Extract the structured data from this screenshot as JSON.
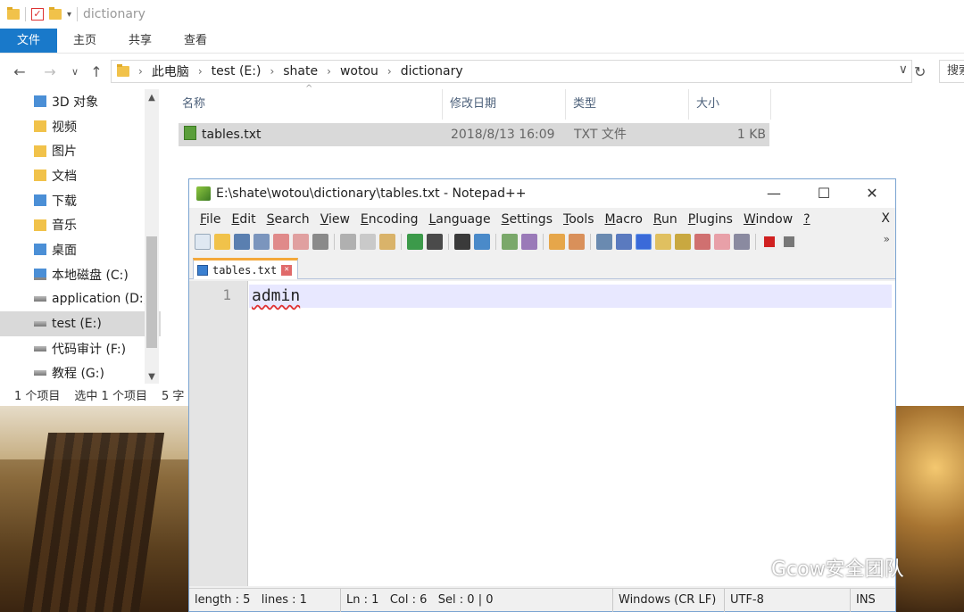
{
  "explorer": {
    "title_path": "dictionary",
    "ribbon_tabs": [
      "文件",
      "主页",
      "共享",
      "查看"
    ],
    "address": [
      "此电脑",
      "test (E:)",
      "shate",
      "wotou",
      "dictionary"
    ],
    "search_placeholder": "搜索",
    "nav_items": [
      {
        "label": "3D 对象",
        "icon": "3d-objects-icon"
      },
      {
        "label": "视频",
        "icon": "video-folder-icon"
      },
      {
        "label": "图片",
        "icon": "pictures-folder-icon"
      },
      {
        "label": "文档",
        "icon": "documents-folder-icon"
      },
      {
        "label": "下载",
        "icon": "downloads-folder-icon"
      },
      {
        "label": "音乐",
        "icon": "music-folder-icon"
      },
      {
        "label": "桌面",
        "icon": "desktop-folder-icon"
      },
      {
        "label": "本地磁盘 (C:)",
        "icon": "system-drive-icon"
      },
      {
        "label": "application (D:)",
        "icon": "drive-icon"
      },
      {
        "label": "test (E:)",
        "icon": "drive-icon",
        "selected": true
      },
      {
        "label": "代码审计 (F:)",
        "icon": "drive-icon"
      },
      {
        "label": "教程 (G:)",
        "icon": "drive-icon"
      }
    ],
    "columns": [
      "名称",
      "修改日期",
      "类型",
      "大小"
    ],
    "file": {
      "name": "tables.txt",
      "modified": "2018/8/13 16:09",
      "type": "TXT 文件",
      "size": "1 KB"
    },
    "status": {
      "count": "1 个项目",
      "selected": "选中 1 个项目",
      "size": "5 字"
    }
  },
  "npp": {
    "title": "E:\\shate\\wotou\\dictionary\\tables.txt - Notepad++",
    "menu": [
      {
        "ul": "F",
        "rest": "ile"
      },
      {
        "ul": "E",
        "rest": "dit"
      },
      {
        "ul": "S",
        "rest": "earch"
      },
      {
        "ul": "V",
        "rest": "iew"
      },
      {
        "ul": "E",
        "rest": "ncoding"
      },
      {
        "ul": "L",
        "rest": "anguage"
      },
      {
        "ul": "S",
        "rest": "ettings"
      },
      {
        "ul": "T",
        "rest": "ools"
      },
      {
        "ul": "M",
        "rest": "acro"
      },
      {
        "ul": "R",
        "rest": "un"
      },
      {
        "ul": "P",
        "rest": "lugins"
      },
      {
        "ul": "W",
        "rest": "indow"
      },
      {
        "ul": "?",
        "rest": ""
      }
    ],
    "menu_close": "X",
    "tab_label": "tables.txt",
    "line_number": "1",
    "content": "admin",
    "status": {
      "length": "length : 5",
      "lines": "lines : 1",
      "ln": "Ln : 1",
      "col": "Col : 6",
      "sel": "Sel : 0 | 0",
      "eol": "Windows (CR LF)",
      "encoding": "UTF-8",
      "mode": "INS"
    }
  },
  "watermark": "Gcow安全团队"
}
